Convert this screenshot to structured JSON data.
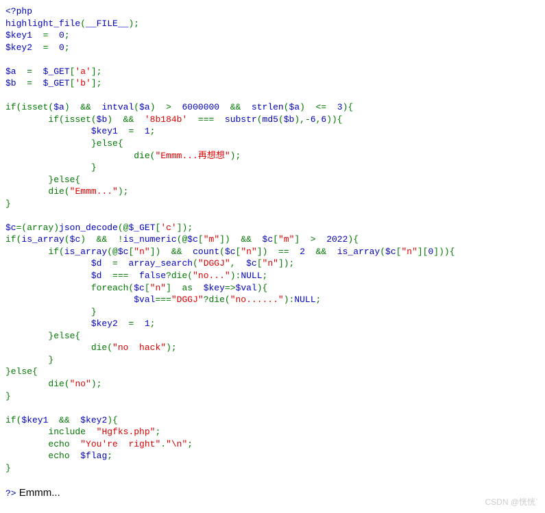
{
  "code": {
    "l1_open": "<?php",
    "l2": {
      "fn": "highlight_file",
      "p1": "(",
      "arg": "__FILE__",
      "p2": ");"
    },
    "l3": {
      "v": "$key1",
      "eq": "  =  ",
      "n": "0",
      "sc": ";"
    },
    "l4": {
      "v": "$key2",
      "eq": "  =  ",
      "n": "0",
      "sc": ";"
    },
    "l6": {
      "v": "$a",
      "eq": "  =  ",
      "g": "$_GET",
      "br1": "[",
      "s": "'a'",
      "br2": "];"
    },
    "l7": {
      "v": "$b",
      "eq": "  =  ",
      "g": "$_GET",
      "br1": "[",
      "s": "'b'",
      "br2": "];"
    },
    "l9": {
      "if": "if(",
      "isset": "isset",
      "p1": "(",
      "a": "$a",
      "p2": ")  &&  ",
      "intval": "intval",
      "p3": "(",
      "a2": "$a",
      "p4": ")  >  ",
      "n": "6000000",
      "p5": "  &&  ",
      "strlen": "strlen",
      "p6": "(",
      "a3": "$a",
      "p7": ")  <=  ",
      "n2": "3",
      "p8": "){"
    },
    "l10": {
      "if": "if(",
      "isset": "isset",
      "p1": "(",
      "b": "$b",
      "p2": ")  &&  ",
      "s": "'8b184b'",
      "p3": "  ===  ",
      "substr": "substr",
      "p4": "(",
      "md5": "md5",
      "p5": "(",
      "b2": "$b",
      "p6": "),-",
      "n1": "6",
      "c": ",",
      "n2": "6",
      "p7": ")){"
    },
    "l11": {
      "v": "$key1",
      "eq": "  =  ",
      "n": "1",
      "sc": ";"
    },
    "l12": {
      "else": "}else{"
    },
    "l13": {
      "die": "die(",
      "s": "\"Emmm...再想想\"",
      "p": ");"
    },
    "l14": "}",
    "l15": {
      "else": "}else{"
    },
    "l16": {
      "die": "die(",
      "s": "\"Emmm...\"",
      "p": ");"
    },
    "l17": "}",
    "l19": {
      "v": "$c",
      "eq": "=(",
      "arr": "array",
      "p1": ")",
      "jd": "json_decode",
      "p2": "(@",
      "g": "$_GET",
      "br1": "[",
      "s": "'c'",
      "br2": "]);"
    },
    "l20": {
      "if": "if(",
      "ia": "is_array",
      "p1": "(",
      "c": "$c",
      "p2": ")  &&  !",
      "in": "is_numeric",
      "p3": "(@",
      "c2": "$c",
      "br1": "[",
      "s1": "\"m\"",
      "br2": "])  &&  ",
      "c3": "$c",
      "br3": "[",
      "s2": "\"m\"",
      "br4": "]  >  ",
      "n": "2022",
      "p4": "){"
    },
    "l21": {
      "if": "if(",
      "ia": "is_array",
      "p1": "(@",
      "c": "$c",
      "br1": "[",
      "s1": "\"n\"",
      "br2": "])  &&  ",
      "cnt": "count",
      "p2": "(",
      "c2": "$c",
      "br3": "[",
      "s2": "\"n\"",
      "br4": "])  ==  ",
      "n1": "2",
      "p3": "  &&  ",
      "ia2": "is_array",
      "p4": "(",
      "c3": "$c",
      "br5": "[",
      "s3": "\"n\"",
      "br6": "][",
      "n2": "0",
      "br7": "])){"
    },
    "l22": {
      "v": "$d",
      "eq": "  =  ",
      "as": "array_search",
      "p1": "(",
      "s1": "\"DGGJ\"",
      "c": ",  ",
      "c2": "$c",
      "br1": "[",
      "s2": "\"n\"",
      "br2": "]);"
    },
    "l23": {
      "v": "$d",
      "eq": "  ===  ",
      "false": "false",
      "q": "?",
      "die": "die",
      "p1": "(",
      "s": "\"no...\"",
      "p2": "):",
      "null": "NULL",
      "sc": ";"
    },
    "l24": {
      "fe": "foreach(",
      "c": "$c",
      "br1": "[",
      "s": "\"n\"",
      "br2": "]  as  ",
      "k": "$key",
      "ar": "=>",
      "v": "$val",
      "p": "){"
    },
    "l25": {
      "v": "$val",
      "eq": "===",
      "s1": "\"DGGJ\"",
      "q": "?",
      "die": "die",
      "p1": "(",
      "s2": "\"no......\"",
      "p2": "):",
      "null": "NULL",
      "sc": ";"
    },
    "l26": "}",
    "l27": {
      "v": "$key2",
      "eq": "  =  ",
      "n": "1",
      "sc": ";"
    },
    "l28": {
      "else": "}else{"
    },
    "l29": {
      "die": "die(",
      "s": "\"no  hack\"",
      "p": ");"
    },
    "l30": "}",
    "l31": {
      "else": "}else{"
    },
    "l32": {
      "die": "die(",
      "s": "\"no\"",
      "p": ");"
    },
    "l33": "}",
    "l35": {
      "if": "if(",
      "k1": "$key1",
      "and": "  &&  ",
      "k2": "$key2",
      "p": "){"
    },
    "l36": {
      "inc": "include  ",
      "s": "\"Hgfks.php\"",
      "sc": ";"
    },
    "l37": {
      "echo": "echo  ",
      "s1": "\"You're  right\"",
      "dot": ".",
      "s2": "\"\\n\"",
      "sc": ";"
    },
    "l38": {
      "echo": "echo  ",
      "v": "$flag",
      "sc": ";"
    },
    "l39": "}",
    "close": "?>",
    "output": " Emmm..."
  },
  "watermark": "CSDN @恍恍`"
}
